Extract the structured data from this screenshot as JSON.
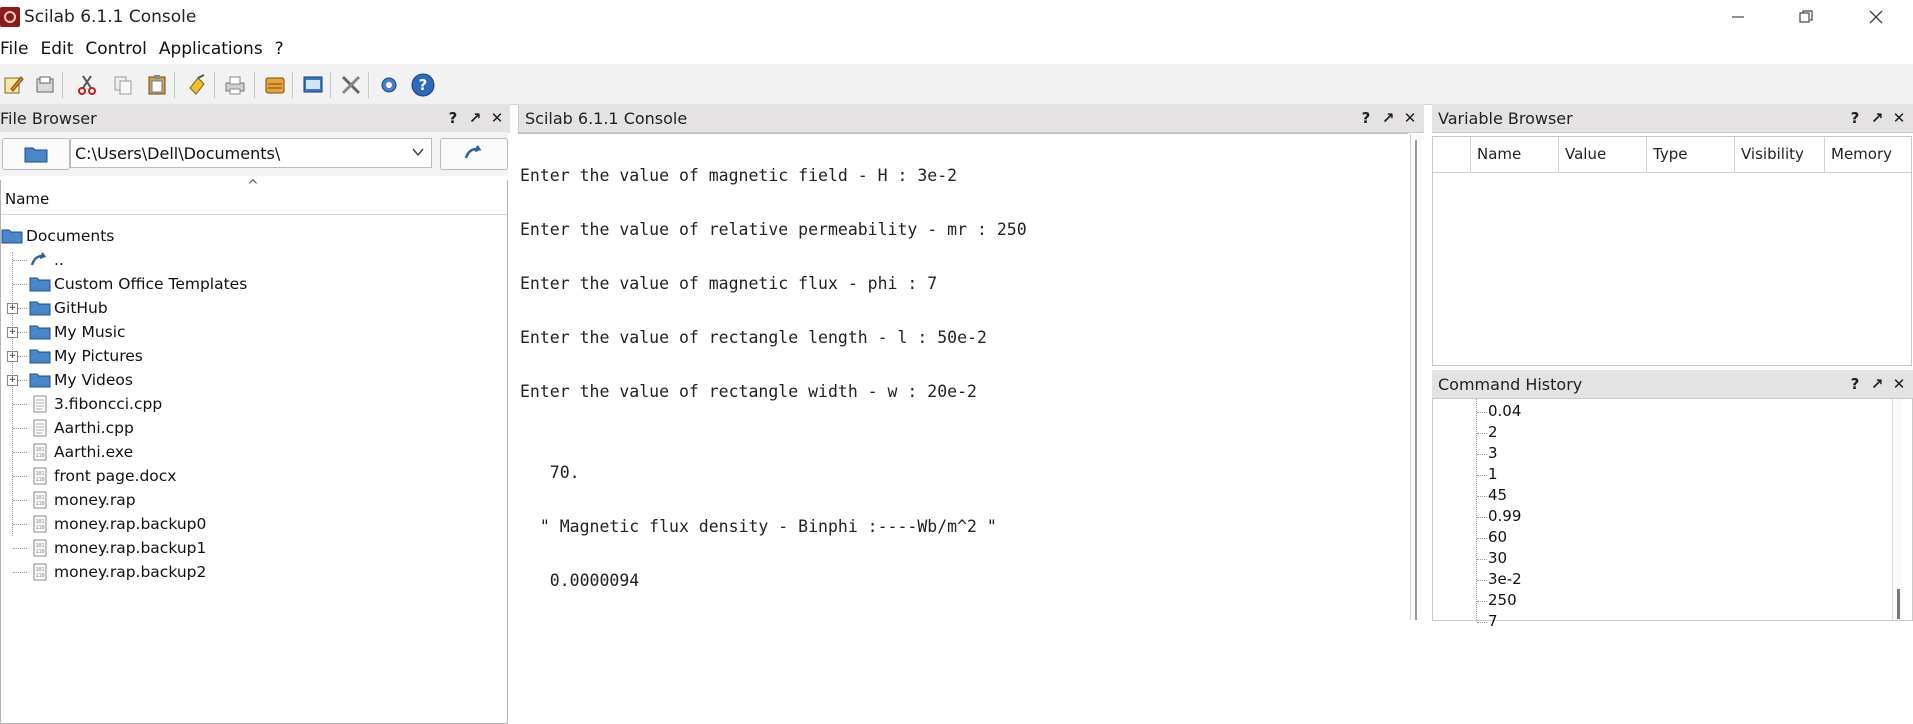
{
  "window": {
    "title": "Scilab 6.1.1 Console",
    "controls": {
      "minimize_icon": "minimize-icon",
      "maximize_icon": "restore-icon",
      "close_icon": "close-icon"
    }
  },
  "menu": [
    "File",
    "Edit",
    "Control",
    "Applications",
    "?"
  ],
  "toolbar_icons": [
    "new-script-icon",
    "open-file-icon",
    "cut-icon",
    "copy-icon",
    "paste-icon",
    "clear-console-icon",
    "print-icon",
    "open-folder-icon",
    "variable-editor-icon",
    "module-manager-icon",
    "preferences-icon",
    "help-icon"
  ],
  "file_browser": {
    "title": "File Browser",
    "path": "C:\\Users\\Dell\\Documents\\",
    "column": "Name",
    "root": "Documents",
    "items": [
      {
        "label": "..",
        "kind": "parent"
      },
      {
        "label": "Custom Office Templates",
        "kind": "folder",
        "expandable": false
      },
      {
        "label": "GitHub",
        "kind": "folder",
        "expandable": true
      },
      {
        "label": "My Music",
        "kind": "folder",
        "expandable": true
      },
      {
        "label": "My Pictures",
        "kind": "folder",
        "expandable": true
      },
      {
        "label": "My Videos",
        "kind": "folder",
        "expandable": true
      },
      {
        "label": "3.fiboncci.cpp",
        "kind": "text"
      },
      {
        "label": "Aarthi.cpp",
        "kind": "text"
      },
      {
        "label": "Aarthi.exe",
        "kind": "binary"
      },
      {
        "label": "front page.docx",
        "kind": "binary"
      },
      {
        "label": "money.rap",
        "kind": "binary"
      },
      {
        "label": "money.rap.backup0",
        "kind": "binary"
      },
      {
        "label": "money.rap.backup1",
        "kind": "binary"
      },
      {
        "label": "money.rap.backup2",
        "kind": "binary"
      }
    ]
  },
  "console": {
    "title": "Scilab 6.1.1 Console",
    "lines": [
      "Enter the value of magnetic field - H : 3e-2",
      "Enter the value of relative permeability - mr : 250",
      "Enter the value of magnetic flux - phi : 7",
      "Enter the value of rectangle length - l : 50e-2",
      "Enter the value of rectangle width - w : 20e-2",
      "   70.",
      "  \" Magnetic flux density - Binphi :----Wb/m^2 \"",
      "   0.0000094"
    ]
  },
  "variable_browser": {
    "title": "Variable Browser",
    "columns": [
      "",
      "Name",
      "Value",
      "Type",
      "Visibility",
      "Memory"
    ]
  },
  "command_history": {
    "title": "Command History",
    "items": [
      "0.04",
      "2",
      "3",
      "1",
      "45",
      "0.99",
      "60",
      "30",
      "3e-2",
      "250",
      "7"
    ]
  },
  "panel_buttons": {
    "help": "?",
    "undock": "↗",
    "close": "✕"
  },
  "colors": {
    "header_bg": "#e4e2e2",
    "folder": "#4a86c8",
    "toolbar_bg": "#f2f2f2"
  }
}
